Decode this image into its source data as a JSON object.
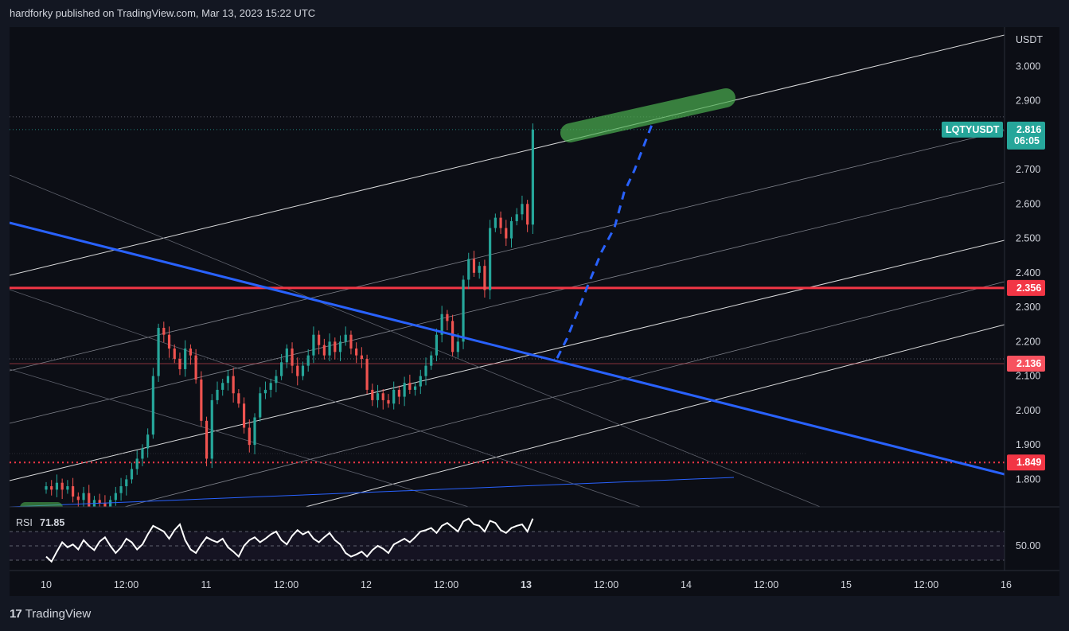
{
  "header": {
    "text": "hardforky published on TradingView.com, Mar 13, 2023 15:22 UTC"
  },
  "footer": {
    "logo_glyph": "17",
    "brand": "TradingView"
  },
  "chart_data": {
    "type": "candlestick",
    "symbol": "LQTYUSDT",
    "currency": "USDT",
    "last_price": "2.816",
    "countdown": "06:05",
    "y_ticks": [
      "3.000",
      "2.900",
      "2.700",
      "2.600",
      "2.500",
      "2.400",
      "2.300",
      "2.200",
      "2.100",
      "2.000",
      "1.900",
      "1.800"
    ],
    "y_tick_values": [
      3.0,
      2.9,
      2.7,
      2.6,
      2.5,
      2.4,
      2.3,
      2.2,
      2.1,
      2.0,
      1.9,
      1.8
    ],
    "ylim": [
      1.72,
      3.1
    ],
    "x_labels": [
      "10",
      "12:00",
      "11",
      "12:00",
      "12",
      "12:00",
      "13",
      "12:00",
      "14",
      "12:00",
      "15",
      "12:00",
      "16"
    ],
    "x_label_bold": [
      false,
      false,
      false,
      false,
      false,
      false,
      true,
      false,
      false,
      false,
      false,
      false,
      false
    ],
    "xlim_hours": [
      0,
      146
    ],
    "x_label_hours": [
      0,
      12,
      24,
      36,
      48,
      60,
      72,
      84,
      96,
      108,
      120,
      132,
      144
    ],
    "levels": [
      {
        "label": "2.356",
        "value": 2.356,
        "color": "#f23645",
        "style": "solid"
      },
      {
        "label": "2.136",
        "value": 2.136,
        "color": "#f7525f",
        "style": "thin"
      },
      {
        "label": "1.849",
        "value": 1.849,
        "color": "#f23645",
        "style": "dotted"
      }
    ],
    "high_marker": 2.853,
    "candles_close": [
      1.78,
      1.77,
      1.79,
      1.77,
      1.78,
      1.75,
      1.74,
      1.76,
      1.72,
      1.74,
      1.73,
      1.72,
      1.74,
      1.76,
      1.78,
      1.8,
      1.83,
      1.86,
      1.89,
      1.93,
      2.1,
      2.24,
      2.22,
      2.18,
      2.15,
      2.12,
      2.18,
      2.16,
      2.09,
      1.97,
      1.86,
      2.03,
      2.06,
      2.08,
      2.1,
      2.05,
      2.02,
      1.95,
      1.9,
      1.98,
      2.05,
      2.06,
      2.08,
      2.1,
      2.14,
      2.18,
      2.13,
      2.1,
      2.13,
      2.16,
      2.22,
      2.19,
      2.16,
      2.2,
      2.17,
      2.2,
      2.22,
      2.18,
      2.16,
      2.15,
      2.06,
      2.03,
      2.05,
      2.03,
      2.02,
      2.06,
      2.04,
      2.08,
      2.06,
      2.07,
      2.1,
      2.13,
      2.16,
      2.22,
      2.28,
      2.26,
      2.17,
      2.2,
      2.38,
      2.44,
      2.4,
      2.42,
      2.35,
      2.53,
      2.56,
      2.53,
      2.5,
      2.55,
      2.57,
      2.6,
      2.54,
      2.816
    ],
    "rsi": {
      "label": "RSI",
      "value": "71.85",
      "level_label": "50.00",
      "values": [
        35,
        28,
        42,
        55,
        48,
        52,
        45,
        58,
        50,
        44,
        56,
        62,
        50,
        40,
        48,
        60,
        55,
        45,
        52,
        66,
        78,
        74,
        70,
        60,
        72,
        80,
        58,
        45,
        40,
        52,
        62,
        58,
        55,
        60,
        48,
        42,
        35,
        50,
        58,
        62,
        55,
        60,
        66,
        70,
        58,
        52,
        64,
        72,
        66,
        70,
        60,
        55,
        62,
        68,
        58,
        52,
        40,
        35,
        38,
        42,
        35,
        44,
        50,
        46,
        40,
        52,
        56,
        60,
        55,
        62,
        70,
        72,
        75,
        68,
        78,
        82,
        76,
        70,
        84,
        88,
        80,
        78,
        70,
        85,
        82,
        72,
        68,
        75,
        78,
        80,
        70,
        88
      ]
    }
  }
}
